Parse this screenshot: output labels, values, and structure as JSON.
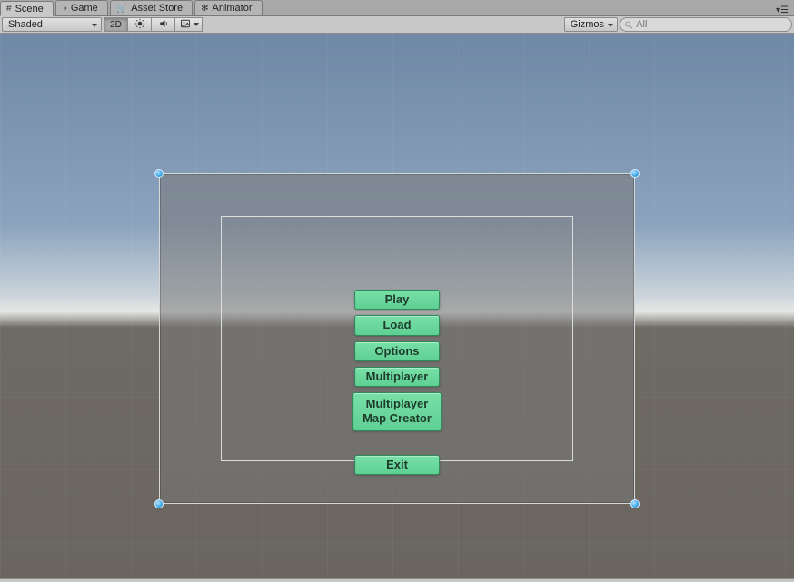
{
  "tabs": {
    "scene": {
      "label": "Scene"
    },
    "game": {
      "label": "Game"
    },
    "asset_store": {
      "label": "Asset Store"
    },
    "animator": {
      "label": "Animator"
    }
  },
  "toolbar": {
    "render_mode": "Shaded",
    "btn_2d": "2D",
    "gizmos": "Gizmos",
    "search_placeholder": "All"
  },
  "menu": {
    "play": "Play",
    "load": "Load",
    "options": "Options",
    "multiplayer": "Multiplayer",
    "map_creator": "Multiplayer\nMap Creator",
    "exit": "Exit"
  }
}
